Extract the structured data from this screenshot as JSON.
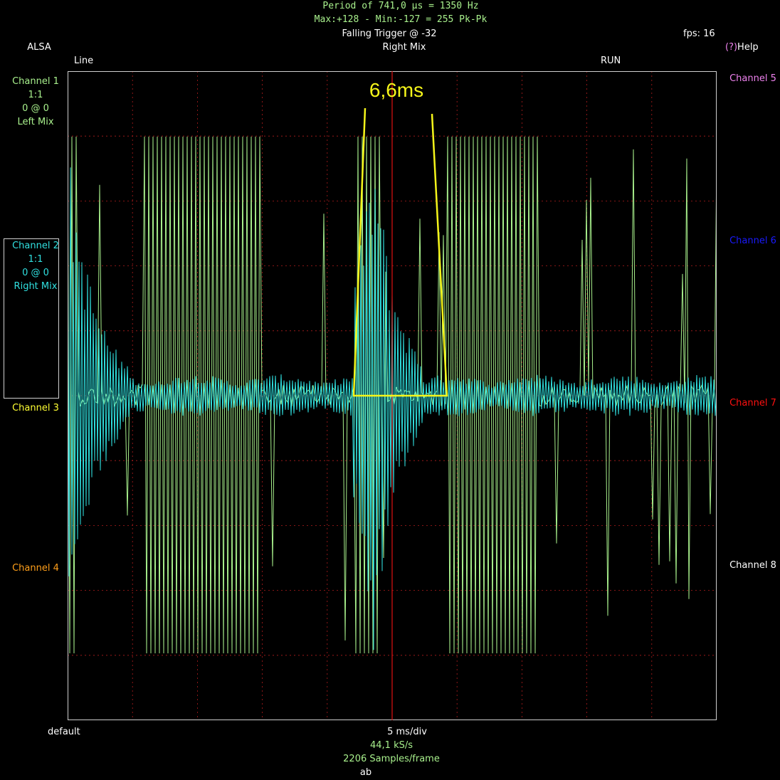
{
  "header": {
    "period_line": "Period of 741,0 µs =  1350 Hz",
    "peak_line": "Max:+128 - Min:-127 = 255 Pk-Pk",
    "trigger": "Falling Trigger @ -32",
    "fps": "fps: 16",
    "source": "ALSA",
    "input": "Right Mix",
    "help_prefix": "(?)",
    "help": "Help",
    "line_label": "Line",
    "run_label": "RUN"
  },
  "left_channels": {
    "ch1": {
      "name": "Channel 1",
      "scale": "1:1",
      "offset": "0 @ 0",
      "source": "Left Mix"
    },
    "ch2": {
      "name": "Channel 2",
      "scale": "1:1",
      "offset": "0 @ 0",
      "source": "Right Mix"
    },
    "ch3": {
      "name": "Channel 3"
    },
    "ch4": {
      "name": "Channel 4"
    }
  },
  "right_channels": {
    "ch5": {
      "name": "Channel 5"
    },
    "ch6": {
      "name": "Channel 6"
    },
    "ch7": {
      "name": "Channel 7"
    },
    "ch8": {
      "name": "Channel 8"
    }
  },
  "footer": {
    "default": "default",
    "timebase": "5 ms/div",
    "rate": "44,1 kS/s",
    "samples": "2206 Samples/frame",
    "ab": "ab"
  },
  "annotation": {
    "label": "6,6ms"
  },
  "colors": {
    "background": "#000000",
    "grid": "#b01c1c",
    "trigger_line": "#e01010",
    "channel1": "#a8f08c",
    "channel2": "#30e0e0",
    "channel3": "#ffff33",
    "channel4": "#ff9f1a",
    "channel5": "#ee82ee",
    "channel6": "#1a1aff",
    "channel7": "#ff1010",
    "channel8": "#ffffff",
    "annotation": "#f5f51a",
    "header_text": "#a8f08c"
  }
}
